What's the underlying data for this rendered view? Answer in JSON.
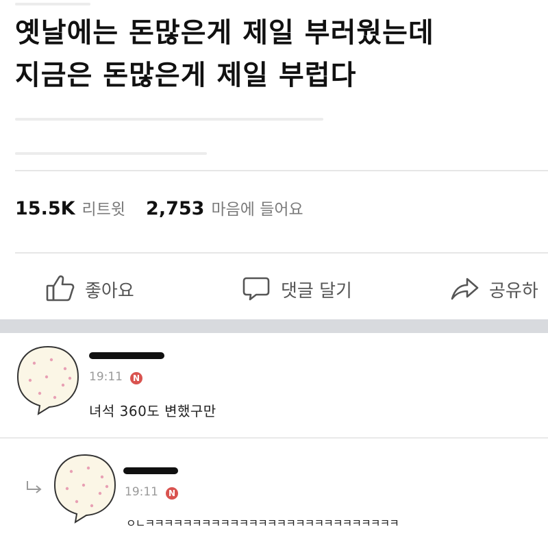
{
  "post": {
    "line1": "옛날에는 돈많은게 제일 부러웠는데",
    "line2": "지금은 돈많은게 제일 부럽다"
  },
  "stats": {
    "retweets_count": "15.5K",
    "retweets_label": "리트윗",
    "likes_count": "2,753",
    "likes_label": "마음에 들어요"
  },
  "actions": {
    "like_label": "좋아요",
    "comment_label": "댓글 달기",
    "share_label": "공유하"
  },
  "comments": [
    {
      "time": "19:11",
      "badge": "N",
      "text": "녀석 360도 변했구만"
    },
    {
      "time": "19:11",
      "badge": "N",
      "text": "ㅇㄴㅋㅋㅋㅋㅋㅋㅋㅋㅋㅋㅋㅋㅋㅋㅋㅋㅋㅋㅋㅋㅋㅋㅋㅋㅋㅋㅋ"
    }
  ],
  "colors": {
    "badge": "#d9534f",
    "band": "#d8dade"
  }
}
